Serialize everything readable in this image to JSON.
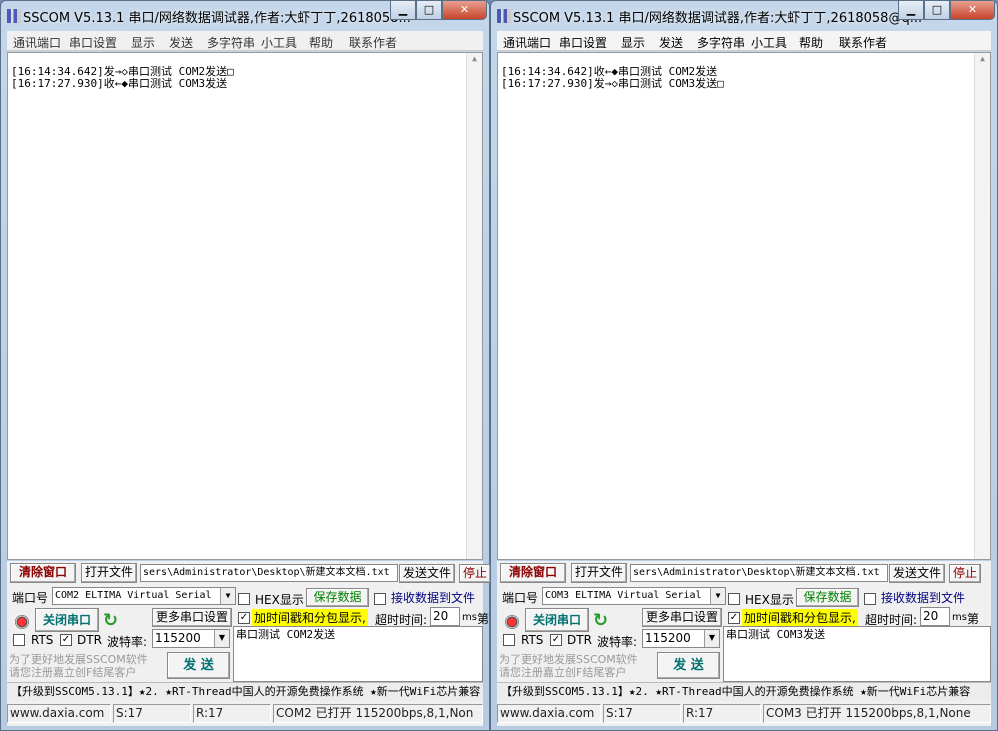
{
  "windows": [
    {
      "title": "SSCOM V5.13.1 串口/网络数据调试器,作者:大虾丁丁,2618058...",
      "menu": [
        "通讯端口",
        "串口设置",
        "显示",
        "发送",
        "多字符串",
        "小工具",
        "帮助",
        "联系作者"
      ],
      "log": [
        "[16:14:34.642]发→◇串口测试 COM2发送□",
        "[16:17:27.930]收←◆串口测试 COM3发送"
      ],
      "clear": "清除窗口",
      "open_file": "打开文件",
      "file_path": "sers\\Administrator\\Desktop\\新建文本文档.txt",
      "send_file": "发送文件",
      "stop": "停止",
      "port_label": "端口号",
      "port_value": "COM2 ELTIMA Virtual Serial",
      "close_port": "关闭串口",
      "more_settings": "更多串口设置",
      "rts": "RTS",
      "dtr": "DTR",
      "baud_label": "波特率:",
      "baud_value": "115200",
      "promo": [
        "为了更好地发展SSCOM软件",
        "请您注册嘉立创F结尾客户"
      ],
      "send": "发 送",
      "hex_display": "HEX显示",
      "save_data": "保存数据",
      "recv_to_file": "接收数据到文件",
      "timestamp": "加时间戳和分包显示,",
      "timeout_label": "超时时间:",
      "timeout_value": "20",
      "ms": "ms",
      "nth": "第",
      "send_text": "串口测试 COM2发送",
      "ticker": "【升级到SSCOM5.13.1】★2. ★RT-Thread中国人的开源免费操作系统 ★新一代WiFi芯片兼容",
      "status": [
        "www.daxia.com",
        "S:17",
        "R:17",
        "COM2 已打开  115200bps,8,1,Non"
      ]
    },
    {
      "title": "SSCOM V5.13.1 串口/网络数据调试器,作者:大虾丁丁,2618058@q...",
      "menu": [
        "通讯端口",
        "串口设置",
        "显示",
        "发送",
        "多字符串",
        "小工具",
        "帮助",
        "联系作者"
      ],
      "log": [
        "[16:14:34.642]收←◆串口测试 COM2发送",
        "[16:17:27.930]发→◇串口测试 COM3发送□"
      ],
      "clear": "清除窗口",
      "open_file": "打开文件",
      "file_path": "sers\\Administrator\\Desktop\\新建文本文档.txt",
      "send_file": "发送文件",
      "stop": "停止",
      "port_label": "端口号",
      "port_value": "COM3 ELTIMA Virtual Serial",
      "close_port": "关闭串口",
      "more_settings": "更多串口设置",
      "rts": "RTS",
      "dtr": "DTR",
      "baud_label": "波特率:",
      "baud_value": "115200",
      "promo": [
        "为了更好地发展SSCOM软件",
        "请您注册嘉立创F结尾客户"
      ],
      "send": "发 送",
      "hex_display": "HEX显示",
      "save_data": "保存数据",
      "recv_to_file": "接收数据到文件",
      "timestamp": "加时间戳和分包显示,",
      "timeout_label": "超时时间:",
      "timeout_value": "20",
      "ms": "ms",
      "nth": "第",
      "send_text": "串口测试 COM3发送",
      "ticker": "【升级到SSCOM5.13.1】★2. ★RT-Thread中国人的开源免费操作系统 ★新一代WiFi芯片兼容",
      "status": [
        "www.daxia.com",
        "S:17",
        "R:17",
        "COM3 已打开  115200bps,8,1,None"
      ]
    }
  ],
  "colors": {
    "clear": "#8b0000",
    "close_port": "#007070",
    "save": "#008000",
    "link": "#000080",
    "highlight": "#ffff00"
  }
}
